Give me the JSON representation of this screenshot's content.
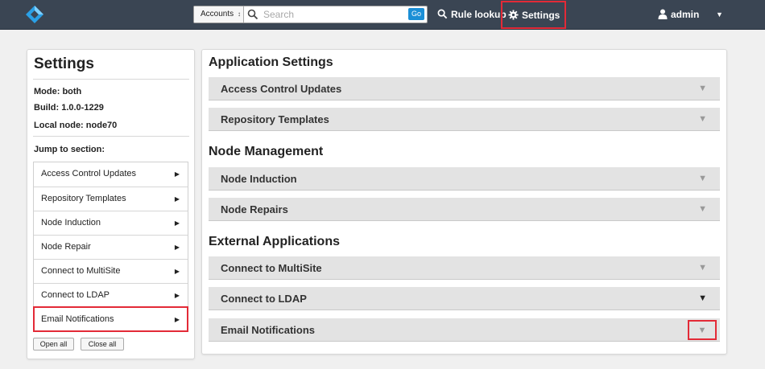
{
  "topbar": {
    "scope_label": "Accounts",
    "search_placeholder": "Search",
    "go_label": "Go",
    "rule_lookup_label": "Rule lookup",
    "settings_label": "Settings",
    "user_label": "admin"
  },
  "sidebar": {
    "title": "Settings",
    "mode": "Mode: both",
    "build": "Build: 1.0.0-1229",
    "local_node": "Local node: node70",
    "jump_label": "Jump to section:",
    "items": [
      {
        "label": "Access Control Updates"
      },
      {
        "label": "Repository Templates"
      },
      {
        "label": "Node Induction"
      },
      {
        "label": "Node Repair"
      },
      {
        "label": "Connect to MultiSite"
      },
      {
        "label": "Connect to LDAP"
      },
      {
        "label": "Email Notifications"
      }
    ],
    "open_all_label": "Open all",
    "close_all_label": "Close all"
  },
  "main": {
    "sections": [
      {
        "title": "Application Settings",
        "panels": [
          {
            "label": "Access Control Updates"
          },
          {
            "label": "Repository Templates"
          }
        ]
      },
      {
        "title": "Node Management",
        "panels": [
          {
            "label": "Node Induction"
          },
          {
            "label": "Node Repairs"
          }
        ]
      },
      {
        "title": "External Applications",
        "panels": [
          {
            "label": "Connect to MultiSite"
          },
          {
            "label": "Connect to LDAP"
          },
          {
            "label": "Email Notifications"
          }
        ]
      }
    ]
  },
  "icons": {
    "logo": "app-logo-icon",
    "search": "search-icon",
    "rule_lookup": "search-icon",
    "settings": "gear-icon",
    "user": "user-icon",
    "caret": "triangle-down-icon",
    "item_arrow": "triangle-right-icon"
  },
  "colors": {
    "topbar_bg": "#3a4553",
    "highlight": "#e32a37",
    "go_button": "#1b8fd6",
    "panel_bg": "#e3e3e3",
    "page_bg": "#f0f0f0"
  }
}
